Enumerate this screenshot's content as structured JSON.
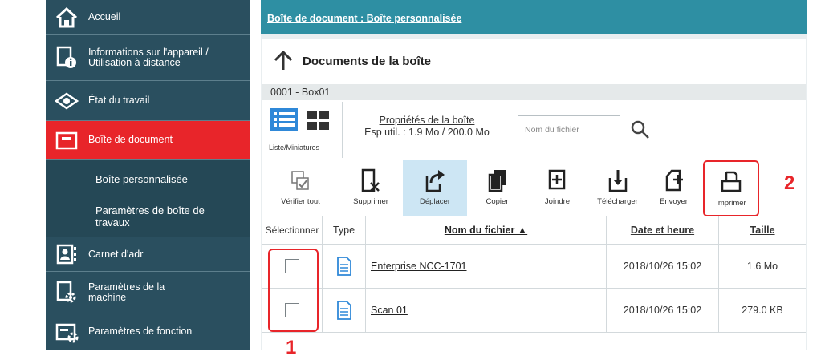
{
  "sidebar": {
    "items": [
      {
        "label": "Accueil",
        "icon": "home-icon"
      },
      {
        "label": "Informations sur l'appareil / Utilisation à distance",
        "icon": "device-info-icon"
      },
      {
        "label": "État du travail",
        "icon": "eye-icon"
      },
      {
        "label": "Boîte de document",
        "icon": "document-box-icon",
        "active": true
      },
      {
        "label": "Carnet d'adr",
        "icon": "address-book-icon"
      },
      {
        "label": "Paramètres de la machine",
        "icon": "machine-settings-icon"
      },
      {
        "label": "Paramètres de fonction",
        "icon": "function-settings-icon"
      }
    ],
    "subitems": [
      {
        "label": "Boîte personnalisée"
      },
      {
        "label": "Paramètres de boîte de travaux"
      }
    ]
  },
  "breadcrumb": "Boîte de document : Boîte personnalisée",
  "panel": {
    "title": "Documents de la boîte",
    "box_name": "0001 - Box01",
    "view_caption": "Liste/Miniatures",
    "properties_link": "Propriétés de la boîte",
    "usage": "Esp util. : 1.9 Mo / 200.0 Mo",
    "search_placeholder": "Nom du fichier"
  },
  "toolbar": {
    "verify_all": "Vérifier tout",
    "delete": "Supprimer",
    "move": "Déplacer",
    "copy": "Copier",
    "join": "Joindre",
    "download": "Télécharger",
    "send": "Envoyer",
    "print": "Imprimer"
  },
  "table": {
    "headers": {
      "select": "Sélectionner",
      "type": "Type",
      "name": "Nom du fichier ▲",
      "date": "Date et heure",
      "size": "Taille"
    },
    "rows": [
      {
        "name": "Enterprise NCC-1701",
        "date": "2018/10/26 15:02",
        "size": "1.6 Mo"
      },
      {
        "name": "Scan 01",
        "date": "2018/10/26 15:02",
        "size": "279.0 KB"
      }
    ]
  },
  "annotations": {
    "one": "1",
    "two": "2"
  },
  "colors": {
    "sidebar": "#2a4f5f",
    "active": "#e8252a",
    "topbar": "#2e8fa3",
    "highlight": "#e8252a"
  }
}
